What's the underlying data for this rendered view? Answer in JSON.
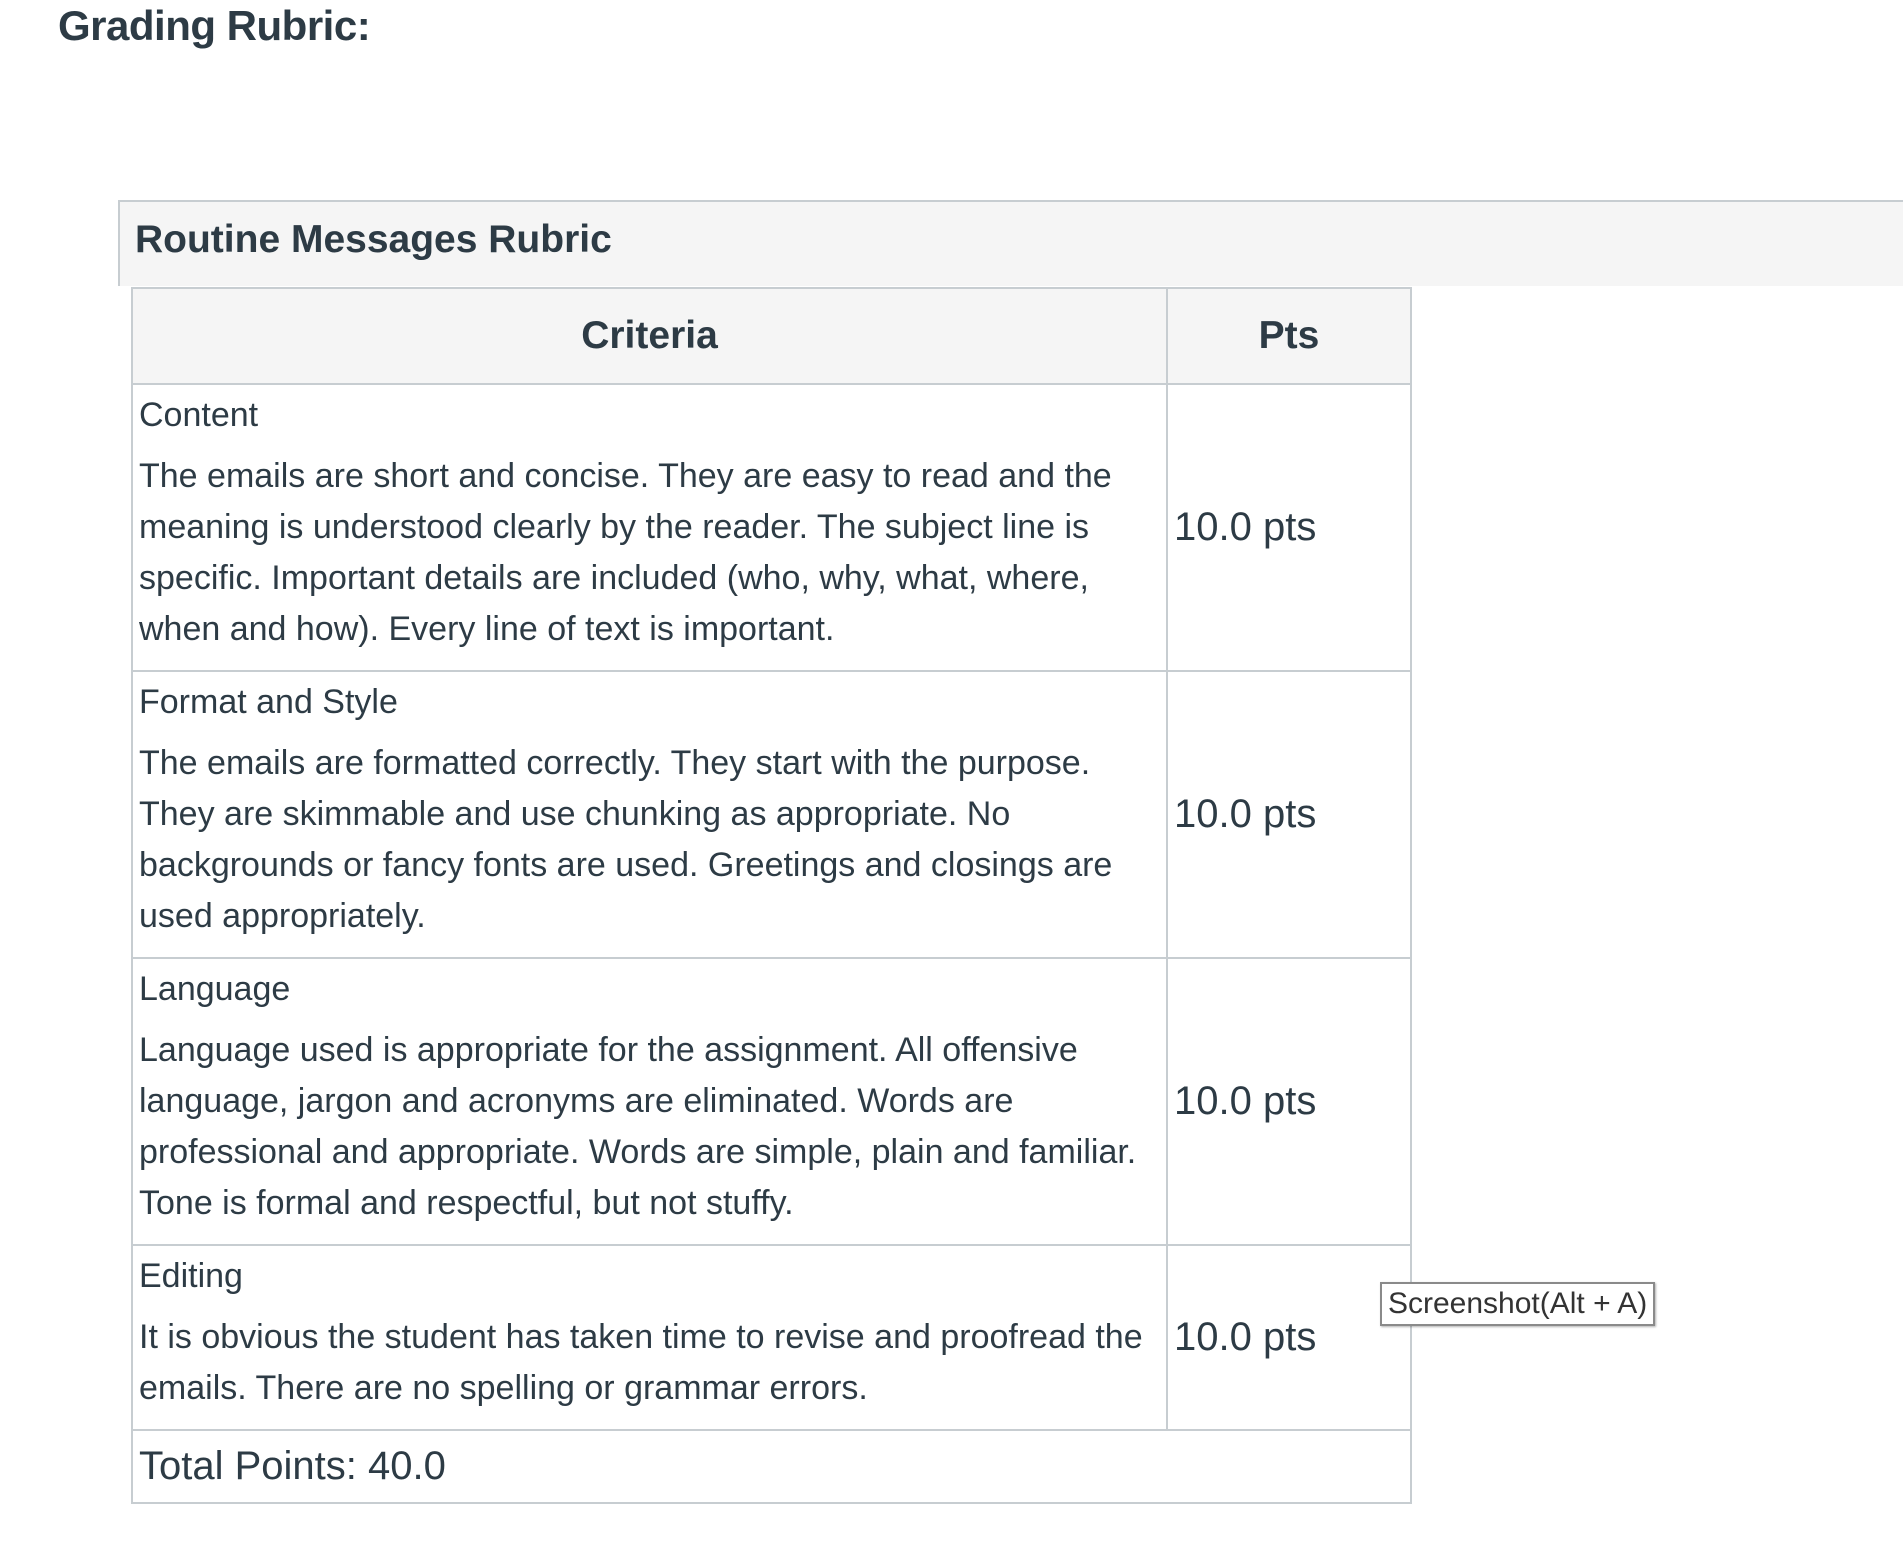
{
  "page": {
    "heading": "Grading Rubric:"
  },
  "rubric": {
    "title": "Routine Messages Rubric",
    "columns": {
      "criteria": "Criteria",
      "pts": "Pts"
    },
    "criteria": [
      {
        "name": "Content",
        "description": "The emails are short and concise. They are easy to read and the meaning is understood clearly by the reader. The subject line is specific. Important details are included (who, why, what, where, when and how). Every line of text is important.",
        "points": "10.0 pts"
      },
      {
        "name": "Format and Style",
        "description": "The emails are formatted correctly. They start with the purpose. They are skimmable and use chunking as appropriate. No backgrounds or fancy fonts are used. Greetings and closings are used appropriately.",
        "points": "10.0 pts"
      },
      {
        "name": "Language",
        "description": "Language used is appropriate for the assignment. All offensive language, jargon and acronyms are eliminated. Words are professional and appropriate. Words are simple, plain and familiar. Tone is formal and respectful, but not stuffy.",
        "points": "10.0 pts"
      },
      {
        "name": "Editing",
        "description": "It is obvious the student has taken time to revise and proofread the emails. There are no spelling or grammar errors.",
        "points": "10.0 pts"
      }
    ],
    "total": "Total Points: 40.0"
  },
  "tooltip": {
    "text": "Screenshot(Alt + A)"
  },
  "colors": {
    "text": "#2d3b45",
    "header_bg": "#f5f5f5",
    "border": "#c7cdd1"
  }
}
